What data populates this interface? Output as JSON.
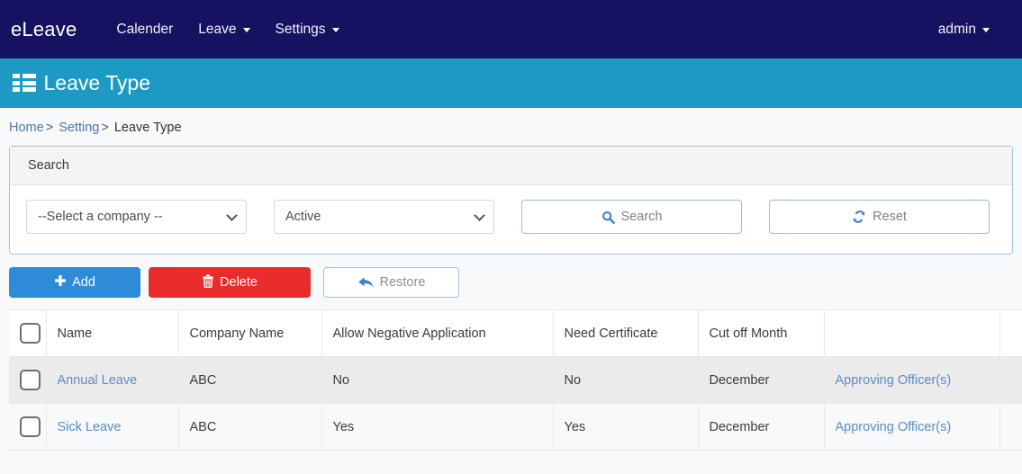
{
  "navbar": {
    "brand": "eLeave",
    "items": [
      {
        "label": "Calender",
        "has_caret": false
      },
      {
        "label": "Leave",
        "has_caret": true
      },
      {
        "label": "Settings",
        "has_caret": true
      }
    ],
    "user": "admin",
    "bg_color": "#171162"
  },
  "pagehead": {
    "title": "Leave Type",
    "icon": "th-list-icon",
    "bg_color": "#1c9ac4"
  },
  "breadcrumb": {
    "home": "Home",
    "sep1": ">",
    "setting": "Setting",
    "sep2": ">",
    "current": "Leave Type"
  },
  "search_card": {
    "header": "Search",
    "company_select": {
      "value": "--Select a company --",
      "options": [
        "--Select a company --"
      ]
    },
    "status_select": {
      "value": "Active",
      "options": [
        "Active"
      ]
    },
    "search_button": "Search",
    "search_icon": "search-icon",
    "reset_button": "Reset",
    "reset_icon": "sync-icon"
  },
  "actions": {
    "add": "Add",
    "add_icon": "plus-icon",
    "add_color": "#2e8bd8",
    "delete": "Delete",
    "delete_icon": "trash-icon",
    "delete_color": "#e92b2b",
    "restore": "Restore",
    "restore_icon": "reply-arrow-icon"
  },
  "table": {
    "columns": [
      "",
      "Name",
      "Company Name",
      "Allow Negative Application",
      "Need Certificate",
      "Cut off Month",
      "",
      ""
    ],
    "rows": [
      {
        "name": "Annual Leave",
        "company": "ABC",
        "allow_negative": "No",
        "need_certificate": "No",
        "cut_off_month": "December",
        "approving": "Approving Officer(s)",
        "extra": ""
      },
      {
        "name": "Sick Leave",
        "company": "ABC",
        "allow_negative": "Yes",
        "need_certificate": "Yes",
        "cut_off_month": "December",
        "approving": "Approving Officer(s)",
        "extra": ""
      }
    ]
  }
}
